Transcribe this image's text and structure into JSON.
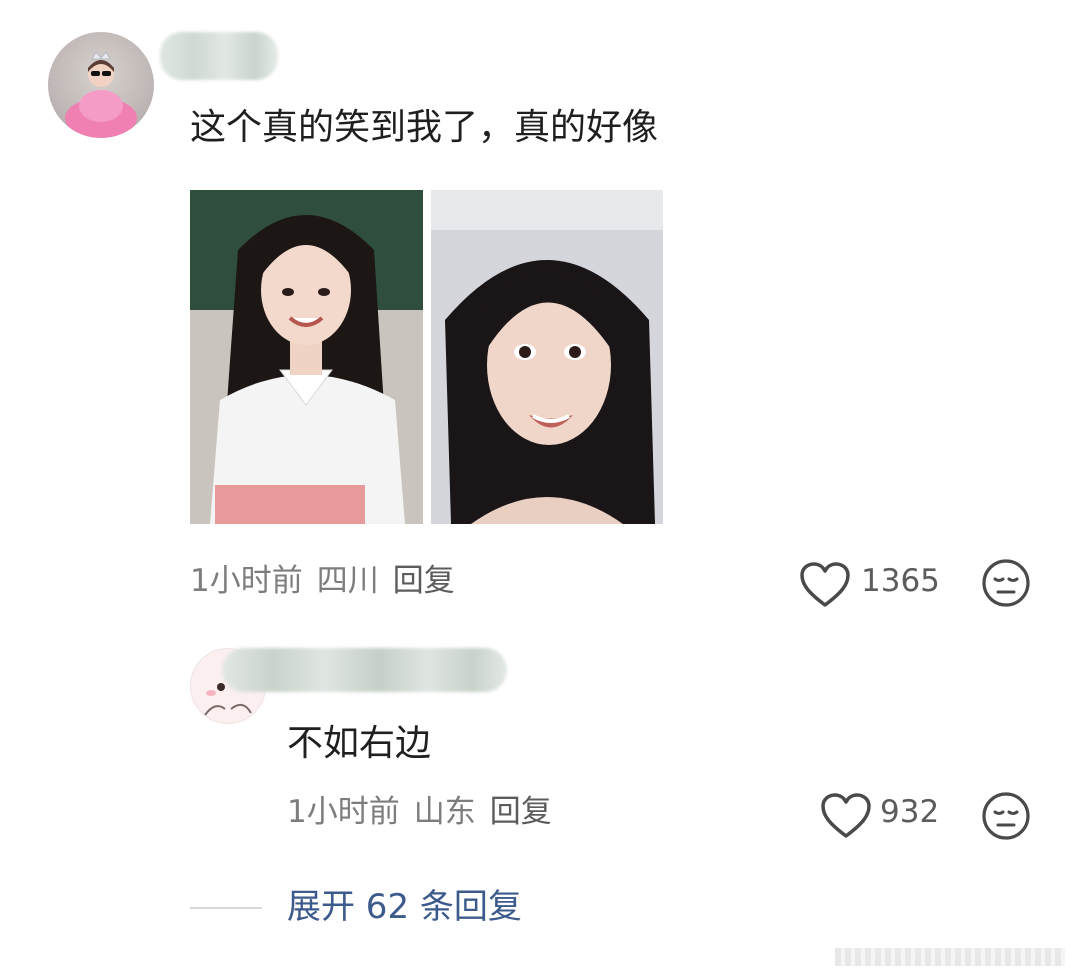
{
  "comment": {
    "text": "这个真的笑到我了，真的好像",
    "time": "1小时前",
    "location": "四川",
    "reply_label": "回复",
    "like_count": "1365"
  },
  "reply": {
    "text": "不如右边",
    "time": "1小时前",
    "location": "山东",
    "reply_label": "回复",
    "like_count": "932"
  },
  "expand": {
    "label": "展开 62 条回复"
  },
  "icons": {
    "like": "heart-icon",
    "dislike": "dislike-face-icon"
  },
  "colors": {
    "link": "#3d5a8c",
    "meta": "#7d7d7d",
    "text": "#1f1f1f"
  }
}
